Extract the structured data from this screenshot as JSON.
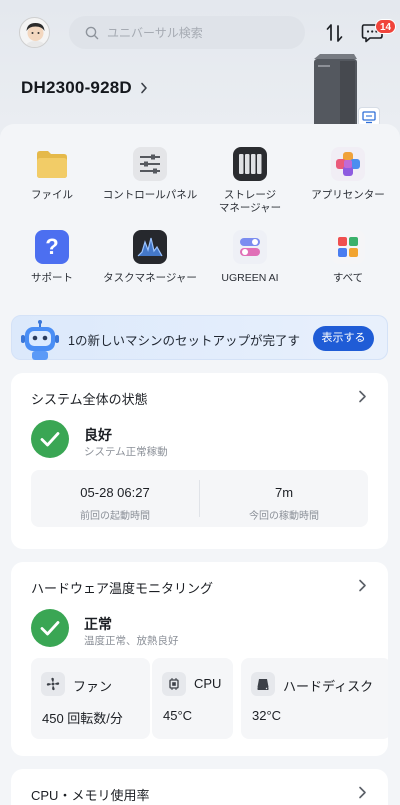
{
  "header": {
    "search_placeholder": "ユニバーサル検索",
    "notification_count": "14"
  },
  "device": {
    "name": "DH2300-928D"
  },
  "apps": [
    {
      "label": "ファイル",
      "icon": "folder-icon"
    },
    {
      "label": "コントロールパネル",
      "icon": "control-panel-icon"
    },
    {
      "label": "ストレージ\nマネージャー",
      "icon": "storage-manager-icon"
    },
    {
      "label": "アプリセンター",
      "icon": "app-center-icon"
    },
    {
      "label": "サポート",
      "icon": "support-icon"
    },
    {
      "label": "タスクマネージャー",
      "icon": "task-manager-icon"
    },
    {
      "label": "UGREEN AI",
      "icon": "ugreen-ai-icon"
    },
    {
      "label": "すべて",
      "icon": "all-apps-icon"
    }
  ],
  "banner": {
    "text": "1の新しいマシンのセットアップが完了す",
    "button": "表示する"
  },
  "system_status": {
    "title": "システム全体の状態",
    "status": "良好",
    "description": "システム正常稼動",
    "last_boot_value": "05-28 06:27",
    "last_boot_label": "前回の起動時間",
    "uptime_value": "7m",
    "uptime_label": "今回の稼動時間"
  },
  "hardware_temp": {
    "title": "ハードウェア温度モニタリング",
    "status": "正常",
    "description": "温度正常、放熱良好",
    "items": [
      {
        "name": "ファン",
        "value": "450 回転数/分",
        "icon": "fan-icon"
      },
      {
        "name": "CPU",
        "value": "45°C",
        "icon": "cpu-icon"
      },
      {
        "name": "ハードディスク",
        "value": "32°C",
        "icon": "hard-disk-icon"
      }
    ]
  },
  "cpu_memory": {
    "title": "CPU・メモリ使用率"
  },
  "colors": {
    "accent": "#1f5cd6",
    "ok_green": "#3aa654",
    "badge_red": "#f0443b"
  }
}
